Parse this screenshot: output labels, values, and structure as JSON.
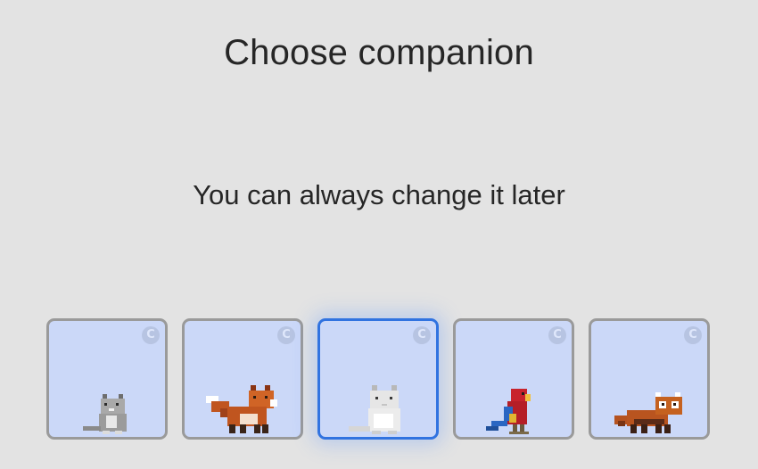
{
  "header": {
    "title": "Choose companion",
    "subtitle": "You can always change it later"
  },
  "companions": [
    {
      "id": "cat-gray",
      "badge": "C",
      "selected": false
    },
    {
      "id": "fox",
      "badge": "C",
      "selected": false
    },
    {
      "id": "cat-white",
      "badge": "C",
      "selected": true
    },
    {
      "id": "parrot",
      "badge": "C",
      "selected": false
    },
    {
      "id": "red-panda",
      "badge": "C",
      "selected": false
    }
  ],
  "colors": {
    "background": "#e3e3e3",
    "card_fill": "#cbd8f8",
    "card_border": "#9a9a9a",
    "selected_border": "#3173e0"
  }
}
